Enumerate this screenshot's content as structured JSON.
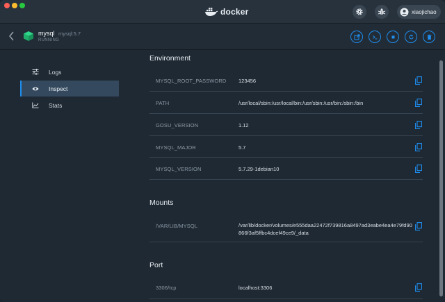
{
  "app": {
    "logo_text": "docker"
  },
  "user": {
    "name": "xiaojichao"
  },
  "container": {
    "name": "mysql",
    "image": "mysql:5.7",
    "status": "RUNNING"
  },
  "sidebar": {
    "items": [
      {
        "label": "Logs",
        "icon": "sliders-icon"
      },
      {
        "label": "Inspect",
        "icon": "eye-icon",
        "active": true
      },
      {
        "label": "Stats",
        "icon": "chart-line-icon"
      }
    ]
  },
  "environment": {
    "title": "Environment",
    "rows": [
      {
        "key": "MYSQL_ROOT_PASSWORD",
        "value": "123456"
      },
      {
        "key": "PATH",
        "value": "/usr/local/sbin:/usr/local/bin:/usr/sbin:/usr/bin:/sbin:/bin"
      },
      {
        "key": "GOSU_VERSION",
        "value": "1.12"
      },
      {
        "key": "MYSQL_MAJOR",
        "value": "5.7"
      },
      {
        "key": "MYSQL_VERSION",
        "value": "5.7.29-1debian10"
      }
    ]
  },
  "mounts": {
    "title": "Mounts",
    "rows": [
      {
        "key": "/VAR/LIB/MYSQL",
        "value": "/var/lib/docker/volumes/e555daa22472f739816a8497ad3eabe4ea4e79fd90866f3af5ffbc4dcef49ce9/_data"
      }
    ]
  },
  "port": {
    "title": "Port",
    "rows": [
      {
        "key": "3306/tcp",
        "value": "localhost:3306"
      }
    ]
  },
  "colors": {
    "accent": "#1e8ef0",
    "background": "#1f2933",
    "active_nav": "#34495e"
  }
}
